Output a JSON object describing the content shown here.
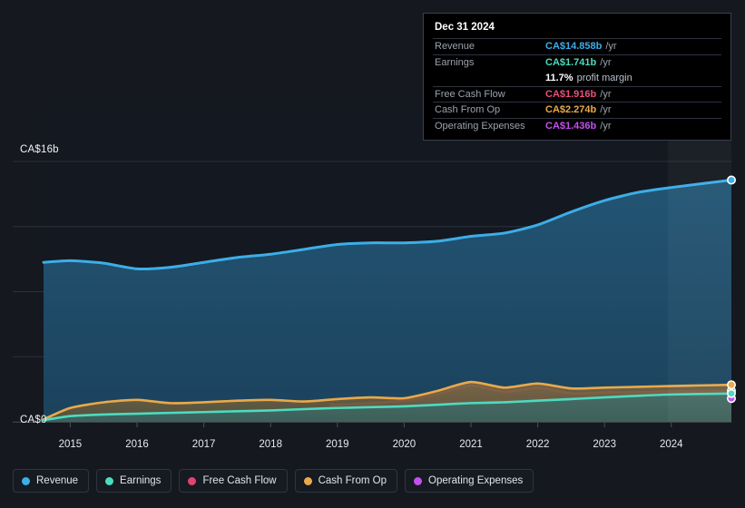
{
  "tooltip": {
    "date": "Dec 31 2024",
    "rows": [
      {
        "key": "Revenue",
        "value": "CA$14.858b",
        "unit": "/yr",
        "color": "#3caee8"
      },
      {
        "key": "Earnings",
        "value": "CA$1.741b",
        "unit": "/yr",
        "color": "#4ddbc0"
      },
      {
        "key": "",
        "value": "11.7%",
        "unit": "profit margin",
        "color": "#ffffff",
        "is_margin": true
      },
      {
        "key": "Free Cash Flow",
        "value": "CA$1.916b",
        "unit": "/yr",
        "color": "#e94f7e"
      },
      {
        "key": "Cash From Op",
        "value": "CA$2.274b",
        "unit": "/yr",
        "color": "#eaa94a"
      },
      {
        "key": "Operating Expenses",
        "value": "CA$1.436b",
        "unit": "/yr",
        "color": "#c44ff0"
      }
    ]
  },
  "legend": {
    "items": [
      {
        "label": "Revenue",
        "color": "#3caee8"
      },
      {
        "label": "Earnings",
        "color": "#4ddbc0"
      },
      {
        "label": "Free Cash Flow",
        "color": "#e0446f"
      },
      {
        "label": "Cash From Op",
        "color": "#eaa94a"
      },
      {
        "label": "Operating Expenses",
        "color": "#c44ff0"
      }
    ]
  },
  "axes": {
    "y_top_label": "CA$16b",
    "y_bottom_label": "CA$0",
    "x_labels": [
      "2015",
      "2016",
      "2017",
      "2018",
      "2019",
      "2020",
      "2021",
      "2022",
      "2023",
      "2024"
    ]
  },
  "chart_data": {
    "type": "area",
    "title": "",
    "xlabel": "",
    "ylabel": "CA$",
    "ylim": [
      0,
      16
    ],
    "y_gridlines": [
      0,
      4,
      8,
      12,
      16
    ],
    "grid": true,
    "legend_position": "bottom",
    "currency": "CA$",
    "units": "billions per year",
    "x": [
      2014.6,
      2015,
      2015.5,
      2016,
      2016.5,
      2017,
      2017.5,
      2018,
      2018.5,
      2019,
      2019.5,
      2020,
      2020.5,
      2021,
      2021.5,
      2022,
      2022.5,
      2023,
      2023.5,
      2024,
      2024.9
    ],
    "series": [
      {
        "name": "Revenue",
        "color": "#3caee8",
        "fill": "#1d4a6b",
        "values": [
          9.8,
          9.9,
          9.75,
          9.4,
          9.5,
          9.8,
          10.1,
          10.3,
          10.6,
          10.9,
          11.0,
          11.0,
          11.1,
          11.4,
          11.6,
          12.1,
          12.9,
          13.6,
          14.1,
          14.4,
          14.858
        ]
      },
      {
        "name": "Earnings",
        "color": "#4ddbc0",
        "fill": "#2f5f5c",
        "values": [
          0.1,
          0.35,
          0.45,
          0.5,
          0.55,
          0.6,
          0.65,
          0.7,
          0.78,
          0.85,
          0.9,
          0.95,
          1.05,
          1.15,
          1.2,
          1.3,
          1.4,
          1.5,
          1.6,
          1.68,
          1.741
        ]
      },
      {
        "name": "Free Cash Flow",
        "color": "#e0446f",
        "fill": "#6d4452",
        "start_x": 2018.9,
        "values": [
          null,
          null,
          null,
          null,
          null,
          null,
          null,
          null,
          null,
          1.05,
          1.15,
          1.3,
          1.7,
          2.25,
          1.85,
          2.1,
          1.75,
          1.8,
          1.82,
          1.88,
          1.916
        ]
      },
      {
        "name": "Cash From Op",
        "color": "#eaa94a",
        "fill": "#6a5c3f",
        "values": [
          0.15,
          0.85,
          1.2,
          1.35,
          1.15,
          1.2,
          1.3,
          1.35,
          1.25,
          1.4,
          1.5,
          1.45,
          1.9,
          2.45,
          2.1,
          2.35,
          2.05,
          2.1,
          2.15,
          2.2,
          2.274
        ]
      },
      {
        "name": "Operating Expenses",
        "color": "#c44ff0",
        "fill": "#6a4a8e",
        "start_x": 2019.95,
        "values": [
          null,
          null,
          null,
          null,
          null,
          null,
          null,
          null,
          null,
          null,
          null,
          1.35,
          1.3,
          1.2,
          1.32,
          1.38,
          1.35,
          1.38,
          1.4,
          1.42,
          1.436
        ]
      }
    ]
  }
}
